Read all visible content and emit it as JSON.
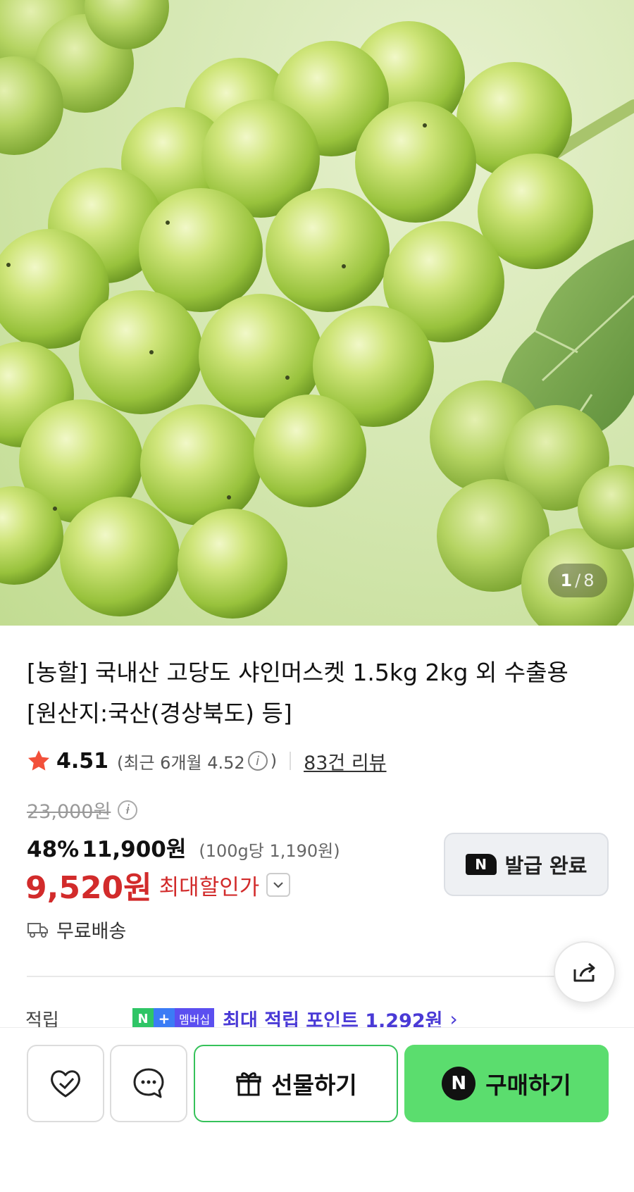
{
  "hero": {
    "image_name": "shine-muscat-grapes",
    "page_current": "1",
    "page_separator": "/",
    "page_total": "8"
  },
  "product": {
    "title_line1": "[농할] 국내산 고당도 샤인머스켓 1.5kg 2kg 외 수출용",
    "title_line2": "[원산지:국산(경상북도) 등]",
    "rating": "4.51",
    "recent_rating_prefix": "(최근 6개월 4.52",
    "recent_rating_suffix": ")",
    "review_count": "83건 리뷰",
    "original_price": "23,000원",
    "discount": "48%",
    "sale_price": "11,900원",
    "unit_price": "(100g당 1,190원)",
    "max_discount_price": "9,520원",
    "max_discount_label": "최대할인가",
    "coupon_badge": "N",
    "coupon_label": "발급 완료",
    "shipping": "무료배송",
    "points_label": "적립",
    "membership_n": "N",
    "membership_plus": "+",
    "membership_text": "멤버십",
    "points_text": "최대 적립 포인트 1,292원"
  },
  "actions": {
    "gift_label": "선물하기",
    "buy_badge": "N",
    "buy_label": "구매하기"
  },
  "colors": {
    "accent_red": "#d22b2b",
    "buy_green": "#5bdd6e",
    "points_purple": "#4a3ad6"
  }
}
